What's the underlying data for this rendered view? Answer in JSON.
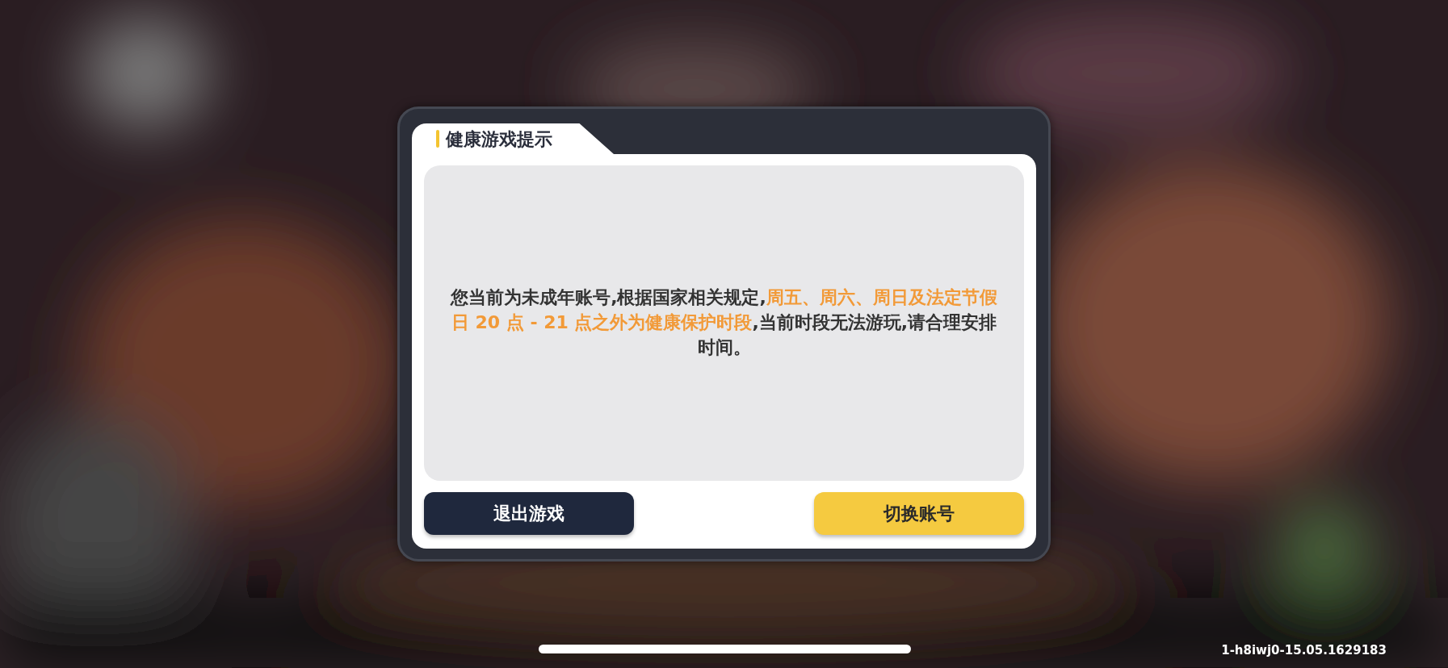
{
  "dialog": {
    "title": "健康游戏提示",
    "message": [
      {
        "text": "您当前为未成年账号,根据国家相关规定,",
        "highlight": false
      },
      {
        "text": "周五、周六、周日及法定节假日 20 点 - 21 点之外为健康保护时段",
        "highlight": true
      },
      {
        "text": ",当前时段无法游玩,请合理安排时间。",
        "highlight": false
      }
    ],
    "buttons": [
      {
        "label": "退出游戏",
        "kind": "dark"
      },
      {
        "label": "切换账号",
        "kind": "primary"
      }
    ]
  },
  "version": "1-h8iwj0-15.05.1629183"
}
